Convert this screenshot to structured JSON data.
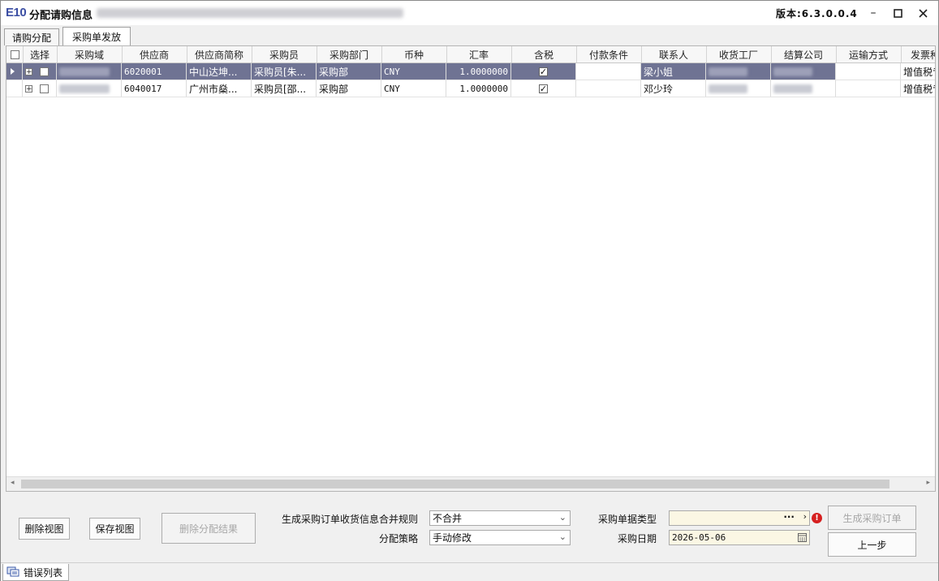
{
  "app": {
    "logo": "E10",
    "title": "分配请购信息",
    "version": "版本:6.3.0.0.4"
  },
  "tabs": [
    {
      "label": "请购分配",
      "active": false
    },
    {
      "label": "采购单发放",
      "active": true
    }
  ],
  "grid": {
    "columns": [
      "选择",
      "采购域",
      "供应商",
      "供应商简称",
      "采购员",
      "采购部门",
      "币种",
      "汇率",
      "含税",
      "付款条件",
      "联系人",
      "收货工厂",
      "结算公司",
      "运输方式",
      "发票种类"
    ],
    "rows": [
      {
        "supplier": "6020001",
        "supplier_short": "中山达坤...",
        "buyer": "采购员[朱...",
        "dept": "采购部",
        "currency": "CNY",
        "rate": "1.0000000",
        "tax_included": true,
        "payment": "",
        "contact": "梁小姐",
        "transport": "",
        "invoice": "增值税专用"
      },
      {
        "supplier": "6040017",
        "supplier_short": "广州市燊...",
        "buyer": "采购员[邵...",
        "dept": "采购部",
        "currency": "CNY",
        "rate": "1.0000000",
        "tax_included": true,
        "payment": "",
        "contact": "邓少玲",
        "transport": "",
        "invoice": "增值税专用"
      }
    ]
  },
  "footer": {
    "delete_view": "删除视图",
    "save_view": "保存视图",
    "delete_result": "删除分配结果",
    "merge_rule_label": "生成采购订单收货信息合并规则",
    "merge_rule_value": "不合并",
    "strategy_label": "分配策略",
    "strategy_value": "手动修改",
    "doc_type_label": "采购单据类型",
    "doc_type_value": "",
    "date_label": "采购日期",
    "date_value": "2026-05-06",
    "generate": "生成采购订单",
    "prev": "上一步"
  },
  "error_list": {
    "label": "错误列表"
  },
  "colors": {
    "selected_row": "#6f7393",
    "accent": "#3b4ea3",
    "error": "#d62020"
  }
}
